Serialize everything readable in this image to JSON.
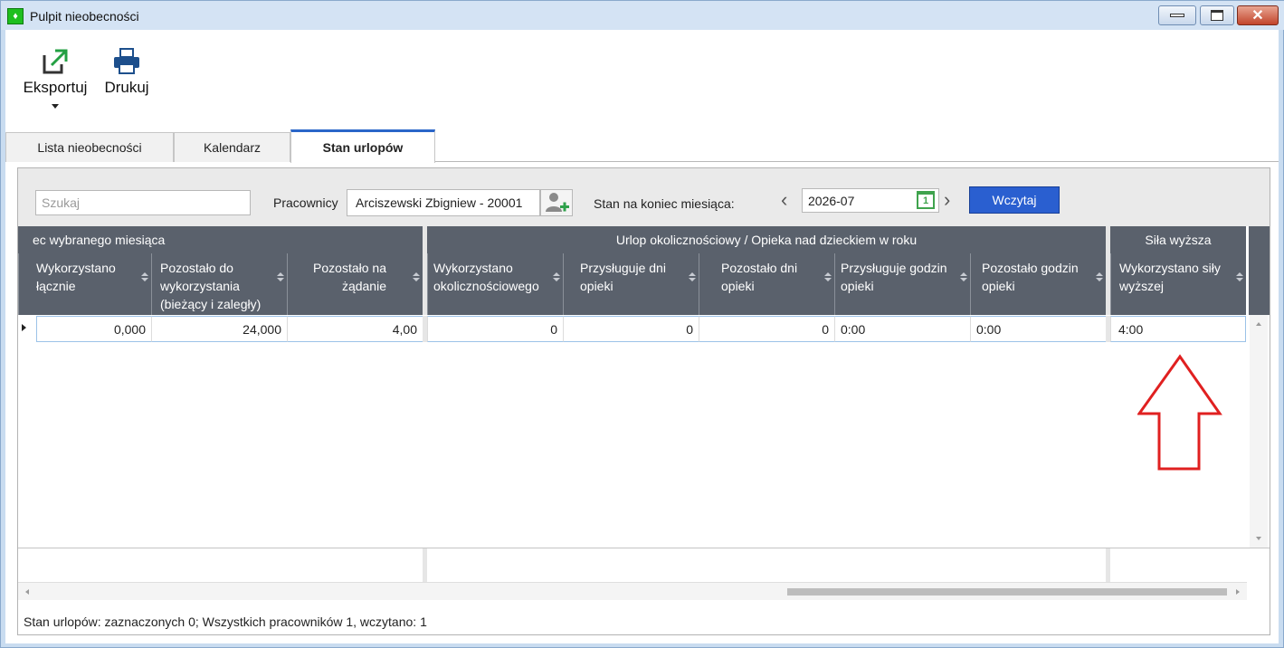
{
  "window": {
    "title": "Pulpit nieobecności"
  },
  "toolbar": {
    "export_label": "Eksportuj",
    "print_label": "Drukuj"
  },
  "tabs": [
    {
      "label": "Lista nieobecności"
    },
    {
      "label": "Kalendarz"
    },
    {
      "label": "Stan urlopów"
    }
  ],
  "filters": {
    "search_placeholder": "Szukaj",
    "employees_label": "Pracownicy",
    "employee_value": "Arciszewski Zbigniew - 20001",
    "month_end_label": "Stan na koniec miesiąca:",
    "month_value": "2026-07",
    "calendar_day": "1",
    "load_label": "Wczytaj"
  },
  "grid": {
    "groups": [
      {
        "label": "ec wybranego miesiąca"
      },
      {
        "label": "Urlop okolicznościowy / Opieka nad dzieckiem w roku"
      },
      {
        "label": "Siła wyższa"
      }
    ],
    "columns": [
      {
        "label": "Wykorzystano łącznie"
      },
      {
        "label": "Pozostało do wykorzystania (bieżący i zaległy)"
      },
      {
        "label": "Pozostało na żądanie"
      },
      {
        "label": "Wykorzystano okolicznościowego"
      },
      {
        "label": "Przysługuje dni opieki"
      },
      {
        "label": "Pozostało dni opieki"
      },
      {
        "label": "Przysługuje godzin opieki"
      },
      {
        "label": "Pozostało godzin opieki"
      },
      {
        "label": "Wykorzystano siły wyższej"
      }
    ],
    "rows": [
      {
        "cells": [
          "0,000",
          "24,000",
          "4,00",
          "0",
          "0",
          "0",
          "0:00",
          "0:00",
          "4:00"
        ]
      }
    ]
  },
  "status": {
    "text": "Stan urlopów: zaznaczonych 0;  Wszystkich pracowników 1, wczytano: 1"
  },
  "colors": {
    "header_bg": "#5a616c",
    "accent": "#2a5fd0",
    "annotation_arrow": "#e02020"
  }
}
